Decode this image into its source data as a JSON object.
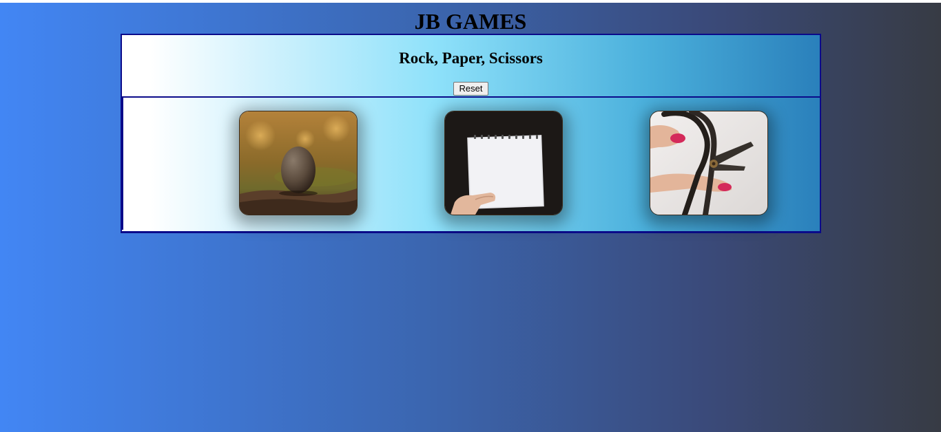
{
  "site": {
    "title": "JB GAMES"
  },
  "game": {
    "title": "Rock, Paper, Scissors",
    "reset_label": "Reset",
    "choices": [
      {
        "id": "rock",
        "icon": "rock-image"
      },
      {
        "id": "paper",
        "icon": "paper-image"
      },
      {
        "id": "scissors",
        "icon": "scissors-image"
      }
    ]
  },
  "colors": {
    "background_start": "#4286f4",
    "background_end": "#373b44",
    "border": "#0a0a8a"
  }
}
